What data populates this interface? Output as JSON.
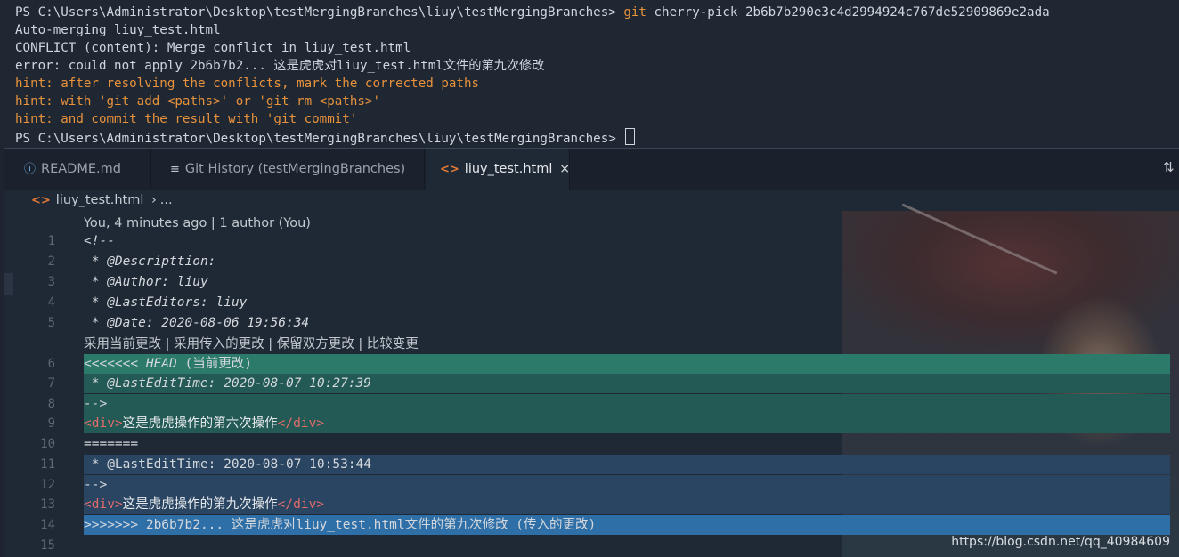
{
  "terminal": {
    "lines": [
      {
        "text": "PS C:\\Users\\Administrator\\Desktop\\testMergingBranches\\liuy\\testMergingBranches> ",
        "cmd_git": "git",
        "cmd_rest": " cherry-pick 2b6b7b290e3c4d2994924c767de52909869e2ada"
      },
      {
        "text": "Auto-merging liuy_test.html"
      },
      {
        "text": "CONFLICT (content): Merge conflict in liuy_test.html"
      },
      {
        "text": "error: could not apply 2b6b7b2... 这是虎虎对liuy_test.html文件的第九次修改"
      },
      {
        "text": "hint: after resolving the conflicts, mark the corrected paths",
        "hint": true
      },
      {
        "text": "hint: with 'git add <paths>' or 'git rm <paths>'",
        "hint": true
      },
      {
        "text": "hint: and commit the result with 'git commit'",
        "hint": true
      },
      {
        "text": "PS C:\\Users\\Administrator\\Desktop\\testMergingBranches\\liuy\\testMergingBranches> "
      }
    ],
    "colors": {
      "hint": "#e8923c",
      "text": "#cfd6dd"
    }
  },
  "tabs": [
    {
      "label": "README.md",
      "icon": "info-icon"
    },
    {
      "label": "Git History (testMergingBranches)",
      "icon": "list-icon"
    },
    {
      "label": "liuy_test.html",
      "icon": "code-icon",
      "active": true,
      "close": "×"
    }
  ],
  "breadcrumb": {
    "file": "liuy_test.html",
    "sep": "›",
    "more": "..."
  },
  "codelens": {
    "blame": "You, 4 minutes ago | 1 author (You)",
    "merge_actions": "采用当前更改 | 采用传入的更改 | 保留双方更改 | 比较变更"
  },
  "code": {
    "l1": "<!--",
    "l2": " * @Descripttion:",
    "l3": " * @Author: liuy",
    "l4": " * @LastEditors: liuy",
    "l5": " * @Date: 2020-08-06 19:56:34",
    "l6_marker": "<<<<<<< ",
    "l6_head": "HEAD",
    "l6_label": " (当前更改)",
    "l7": " * @LastEditTime: 2020-08-07 10:27:39",
    "l8": "-->",
    "l9_open": "<div>",
    "l9_text": "这是虎虎操作的第六次操作",
    "l9_close": "</div>",
    "l10": "=======",
    "l11": " * @LastEditTime: 2020-08-07 10:53:44",
    "l12": "-->",
    "l13_open": "<div>",
    "l13_text": "这是虎虎操作的第九次操作",
    "l13_close": "</div>",
    "l14": ">>>>>>> 2b6b7b2... 这是虎虎对liuy_test.html文件的第九次修改 (传入的更改)"
  },
  "line_numbers": [
    "1",
    "2",
    "3",
    "4",
    "5",
    "6",
    "7",
    "8",
    "9",
    "10",
    "11",
    "12",
    "13",
    "14",
    "15"
  ],
  "watermark": "https://blog.csdn.net/qq_40984609",
  "colors": {
    "current_marker_bg": "#2c7a6a",
    "current_body_bg": "#245a55",
    "incoming_body_bg": "#2a4562",
    "incoming_marker_bg": "#2f6fa8",
    "tag": "#e06b6b"
  }
}
